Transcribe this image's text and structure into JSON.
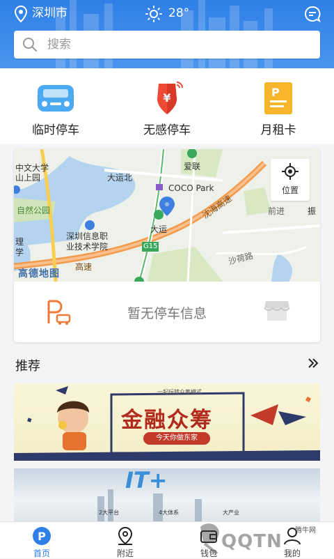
{
  "header": {
    "city": "深圳市",
    "temperature": "28°",
    "search_placeholder": "搜索"
  },
  "quick_actions": [
    {
      "label": "临时停车",
      "icon": "car-icon"
    },
    {
      "label": "无感停车",
      "icon": "shield-yen-icon"
    },
    {
      "label": "月租卡",
      "icon": "parking-card-icon"
    }
  ],
  "map": {
    "locate_label": "位置",
    "logo": "高德地图",
    "labels": {
      "l1": "中文大学",
      "l2": "山上园",
      "l3": "大运北",
      "l4": "爱联",
      "l5": "COCO Park",
      "l6": "自然公园",
      "l7": "深圳信息职",
      "l8": "业技术学院",
      "l9": "大运",
      "l10": "沈海高速",
      "l11": "G15",
      "l12": "高速",
      "l13": "前进",
      "l14": "振",
      "l15": "沙荷路",
      "l16": "理",
      "l17": "学"
    }
  },
  "parking": {
    "empty_text": "暂无停车信息"
  },
  "recommend": {
    "title": "推荐"
  },
  "banners": {
    "b1_note": "一起玩转众筹模式",
    "b1_title": "金融众筹",
    "b1_pill": "今天你做东家",
    "b2_title": "IT+",
    "b2_t1": "2大平台",
    "b2_t2": "4大体系",
    "b2_t3": "大产业"
  },
  "tabs": [
    {
      "label": "首页",
      "active": true
    },
    {
      "label": "附近",
      "active": false
    },
    {
      "label": "钱包",
      "active": false
    },
    {
      "label": "我的",
      "active": false
    }
  ],
  "watermark": {
    "text": "QQTN",
    "small": "腾牛网"
  },
  "colors": {
    "primary": "#2f7fe6",
    "car_icon": "#4aa9f0",
    "shield": "#ef4a35",
    "card": "#f7b52c",
    "parking_p": "#f07a3a"
  }
}
